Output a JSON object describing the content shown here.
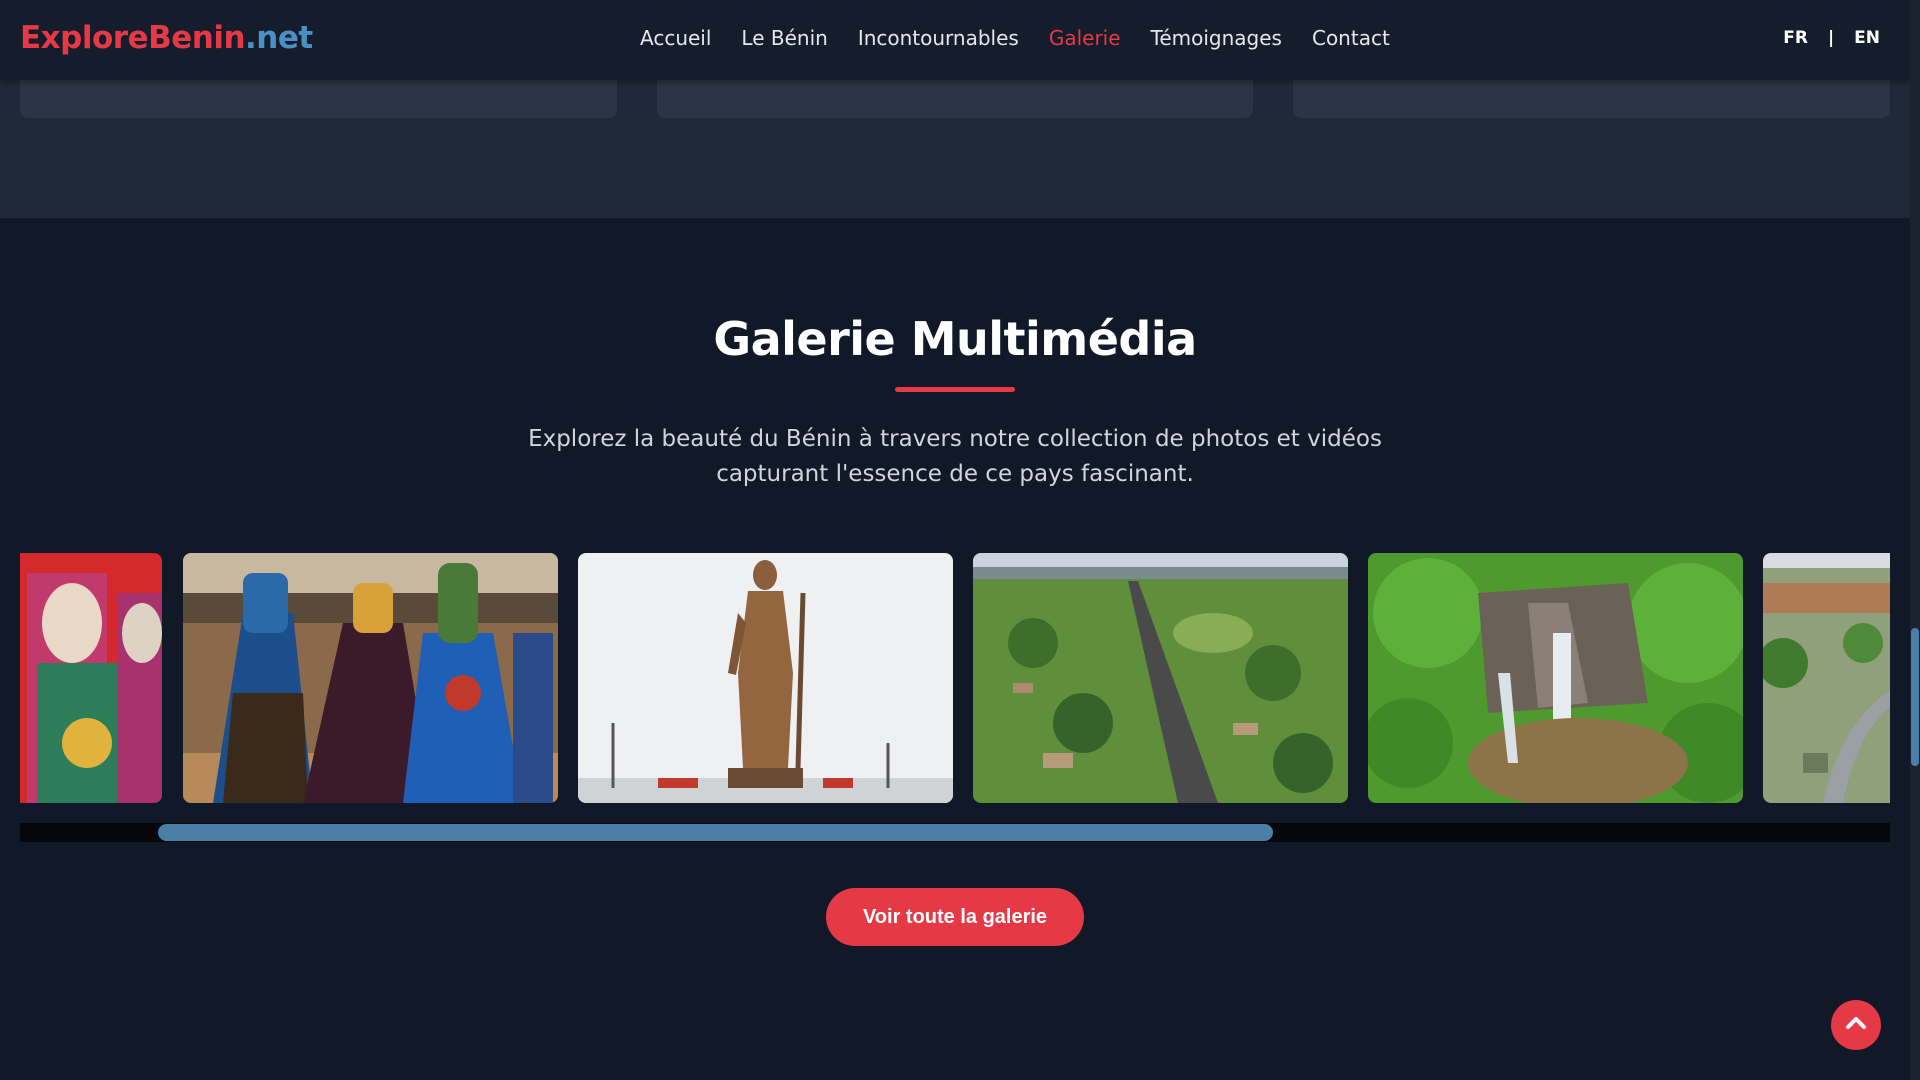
{
  "header": {
    "logo_brand": "ExploreBenin",
    "logo_tld": ".net",
    "nav": [
      {
        "label": "Accueil",
        "active": false
      },
      {
        "label": "Le Bénin",
        "active": false
      },
      {
        "label": "Incontournables",
        "active": false
      },
      {
        "label": "Galerie",
        "active": true
      },
      {
        "label": "Témoignages",
        "active": false
      },
      {
        "label": "Contact",
        "active": false
      }
    ],
    "lang": {
      "fr": "FR",
      "separator": "|",
      "en": "EN"
    }
  },
  "gallery": {
    "title": "Galerie Multimédia",
    "description_line1": "Explorez la beauté du Bénin à travers notre collection de photos et vidéos",
    "description_line2": "capturant l'essence de ce pays fascinant.",
    "images": [
      {
        "name": "masked-costume-crop-image"
      },
      {
        "name": "egungun-dancers-image"
      },
      {
        "name": "amazon-statue-image"
      },
      {
        "name": "aerial-road-landscape-image"
      },
      {
        "name": "waterfall-aerial-image"
      },
      {
        "name": "city-aerial-crop-image"
      }
    ],
    "cta_label": "Voir toute la galerie"
  },
  "colors": {
    "accent": "#e63946",
    "brand_blue": "#4a90c4",
    "background": "#111827"
  },
  "icons": {
    "back_to_top": "chevron-up-icon"
  }
}
